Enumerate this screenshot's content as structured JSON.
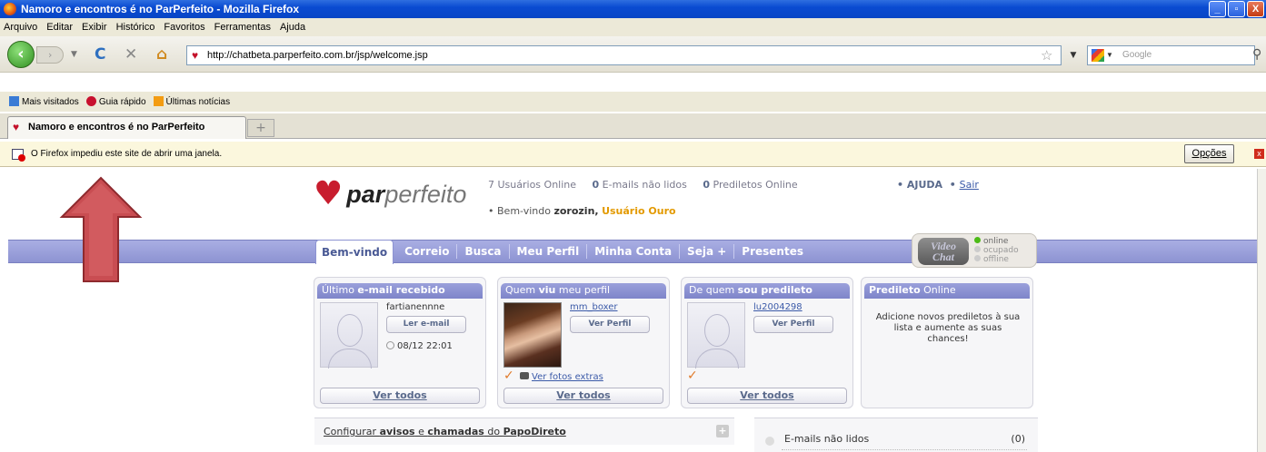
{
  "window": {
    "title": "Namoro e encontros é no ParPerfeito - Mozilla Firefox",
    "buttons": [
      "_",
      "▫",
      "X"
    ]
  },
  "menu": [
    "Arquivo",
    "Editar",
    "Exibir",
    "Histórico",
    "Favoritos",
    "Ferramentas",
    "Ajuda"
  ],
  "nav": {
    "url": "http://chatbeta.parperfeito.com.br/jsp/welcome.jsp",
    "search_placeholder": "Google"
  },
  "bookmarks": [
    "Mais visitados",
    "Guia rápido",
    "Últimas notícias"
  ],
  "tab": {
    "title": "Namoro e encontros é no ParPerfeito"
  },
  "notification": {
    "text": "O Firefox impediu este site de abrir uma janela.",
    "options_label": "Opções"
  },
  "site": {
    "logo": {
      "bold": "par",
      "rest": "perfeito"
    },
    "stats": {
      "users_count": "7",
      "users_label": "Usuários Online",
      "emails_count": "0",
      "emails_label": "E-mails não lidos",
      "fav_count": "0",
      "fav_label": "Prediletos Online"
    },
    "help": "AJUDA",
    "logout": "Sair",
    "welcome_prefix": "Bem-vindo",
    "username": "zorozin,",
    "membership": "Usuário Ouro",
    "tabs": [
      "Bem-vindo",
      "Correio",
      "Busca",
      "Meu Perfil",
      "Minha Conta",
      "Seja +",
      "Presentes"
    ],
    "videochat": {
      "line1": "Video",
      "line2": "Chat",
      "status": [
        "online",
        "ocupado",
        "offline"
      ]
    }
  },
  "cards": {
    "email": {
      "hdr_light": "Último ",
      "hdr_bold": "e-mail recebido",
      "user": "fartianennne",
      "button": "Ler e-mail",
      "date": "08/12 22:01",
      "all": "Ver todos"
    },
    "viewed": {
      "hdr_light": "Quem ",
      "hdr_bold": "viu",
      "hdr_rest": " meu perfil",
      "user": "mm_boxer",
      "button": "Ver Perfil",
      "extras": "Ver fotos extras",
      "all": "Ver todos"
    },
    "favorite_of": {
      "hdr_light": "De quem ",
      "hdr_bold": "sou predileto",
      "user": "lu2004298",
      "button": "Ver Perfil",
      "all": "Ver todos"
    },
    "fav_online": {
      "hdr_bold": "Predileto",
      "hdr_light": " Online",
      "message": "Adicione novos prediletos à sua lista e aumente as suas chances!"
    }
  },
  "config": {
    "prefix": "Configurar ",
    "b1": "avisos",
    "mid": " e ",
    "b2": "chamadas",
    "mid2": " do ",
    "b3": "PapoDireto"
  },
  "unread": {
    "label": "E-mails não lidos",
    "count": "(0)"
  }
}
